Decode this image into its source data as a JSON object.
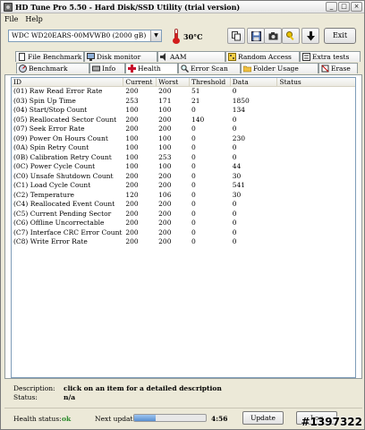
{
  "window": {
    "title": "HD Tune Pro 5.50 - Hard Disk/SSD Utility (trial version)",
    "controls": [
      "_",
      "□",
      "×"
    ]
  },
  "menu": {
    "file": "File",
    "help": "Help"
  },
  "toolbar": {
    "drive": "WDC WD20EARS-00MVWB0 (2000 gB)",
    "temperature": "30",
    "temperature_unit": "°C",
    "exit_label": "Exit",
    "icons": [
      "copy-icon",
      "save-icon",
      "camera-icon",
      "key-icon",
      "down-arrow-icon"
    ]
  },
  "tabs_top": [
    {
      "label": "File Benchmark",
      "icon": "file-icon"
    },
    {
      "label": "Disk monitor",
      "icon": "monitor-icon"
    },
    {
      "label": "AAM",
      "icon": "speaker-icon"
    },
    {
      "label": "Random Access",
      "icon": "random-access-icon"
    },
    {
      "label": "Extra tests",
      "icon": "extra-tests-icon"
    }
  ],
  "tabs_bottom": [
    {
      "label": "Benchmark",
      "icon": "benchmark-icon"
    },
    {
      "label": "Info",
      "icon": "info-icon"
    },
    {
      "label": "Health",
      "icon": "health-icon",
      "active": true
    },
    {
      "label": "Error Scan",
      "icon": "magnifier-icon"
    },
    {
      "label": "Folder Usage",
      "icon": "folder-icon"
    },
    {
      "label": "Erase",
      "icon": "erase-icon"
    }
  ],
  "table": {
    "columns": [
      "ID",
      "Current",
      "Worst",
      "Threshold",
      "Data",
      "Status"
    ],
    "rows": [
      [
        "(01) Raw Read Error Rate",
        "200",
        "200",
        "51",
        "0",
        ""
      ],
      [
        "(03) Spin Up Time",
        "253",
        "171",
        "21",
        "1850",
        ""
      ],
      [
        "(04) Start/Stop Count",
        "100",
        "100",
        "0",
        "134",
        ""
      ],
      [
        "(05) Reallocated Sector Count",
        "200",
        "200",
        "140",
        "0",
        ""
      ],
      [
        "(07) Seek Error Rate",
        "200",
        "200",
        "0",
        "0",
        ""
      ],
      [
        "(09) Power On Hours Count",
        "100",
        "100",
        "0",
        "230",
        ""
      ],
      [
        "(0A) Spin Retry Count",
        "100",
        "100",
        "0",
        "0",
        ""
      ],
      [
        "(0B) Calibration Retry Count",
        "100",
        "253",
        "0",
        "0",
        ""
      ],
      [
        "(0C) Power Cycle Count",
        "100",
        "100",
        "0",
        "44",
        ""
      ],
      [
        "(C0) Unsafe Shutdown Count",
        "200",
        "200",
        "0",
        "30",
        ""
      ],
      [
        "(C1) Load Cycle Count",
        "200",
        "200",
        "0",
        "541",
        ""
      ],
      [
        "(C2) Temperature",
        "120",
        "106",
        "0",
        "30",
        ""
      ],
      [
        "(C4) Reallocated Event Count",
        "200",
        "200",
        "0",
        "0",
        ""
      ],
      [
        "(C5) Current Pending Sector",
        "200",
        "200",
        "0",
        "0",
        ""
      ],
      [
        "(C6) Offline Uncorrectable",
        "200",
        "200",
        "0",
        "0",
        ""
      ],
      [
        "(C7) Interface CRC Error Count",
        "200",
        "200",
        "0",
        "0",
        ""
      ],
      [
        "(C8) Write Error Rate",
        "200",
        "200",
        "0",
        "0",
        ""
      ]
    ]
  },
  "description": {
    "label": "Description:",
    "value": "click on an item for a detailed description",
    "status_label": "Status:",
    "status_value": "n/a"
  },
  "status_bar": {
    "health_label": "Health status:",
    "health_value": "ok",
    "next_update_label": "Next update:",
    "progress": 0.3,
    "time": "4:56",
    "update_label": "Update",
    "log_label": "Log"
  },
  "watermark": "#1397322",
  "colors": {
    "thermometer": "#d21d1d",
    "health_ok": "#2a8a2a",
    "health_tab_icon": "#c8102e"
  }
}
